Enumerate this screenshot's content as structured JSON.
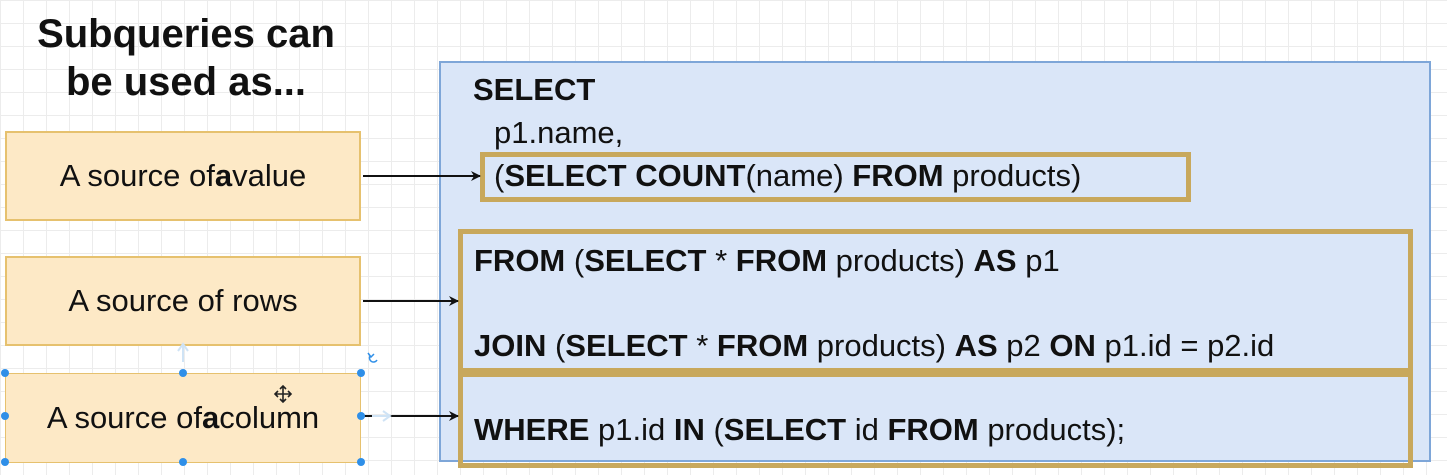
{
  "heading": {
    "line1": "Subqueries can",
    "line2": "be used as..."
  },
  "sources": [
    {
      "pre": "A source of ",
      "bold": "a",
      "post": " value"
    },
    {
      "pre": "A source of rows",
      "bold": "",
      "post": ""
    },
    {
      "pre": "A source of ",
      "bold": "a",
      "post": " column"
    }
  ],
  "sql": {
    "select": "SELECT",
    "col": "p1.name,",
    "sub": {
      "open": "(",
      "k1": "SELECT COUNT",
      "a1": "(name) ",
      "k2": "FROM",
      "a2": " products)"
    },
    "from_line": {
      "k1": "FROM",
      "a1": " (",
      "k2": "SELECT",
      "a2": " * ",
      "k3": "FROM",
      "a3": " products) ",
      "k4": "AS",
      "a4": " p1"
    },
    "join_line": {
      "k1": "JOIN",
      "a1": " (",
      "k2": "SELECT",
      "a2": " * ",
      "k3": "FROM",
      "a3": " products) ",
      "k4": "AS",
      "a4": " p2 ",
      "k5": "ON",
      "a5": " p1.id = p2.id"
    },
    "where_line": {
      "k1": "WHERE",
      "a1": " p1.id ",
      "k2": "IN",
      "a2": " (",
      "k3": "SELECT",
      "a3": " id ",
      "k4": "FROM",
      "a4": " products);"
    }
  },
  "colors": {
    "source_fill": "#fde9c6",
    "source_border": "#e6c16e",
    "sql_fill": "#dae6f8",
    "sql_border": "#7ea6d8",
    "highlight_border": "#c8a85c",
    "selection_handle": "#2f8fe8"
  }
}
